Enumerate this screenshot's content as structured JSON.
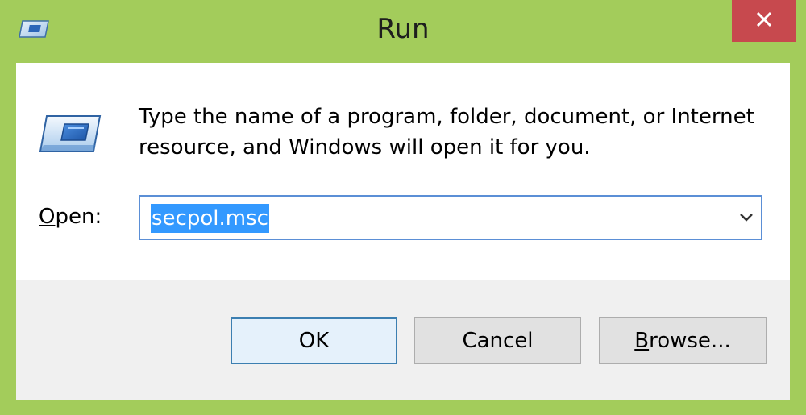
{
  "window": {
    "title": "Run",
    "accent_color": "#a3cc5b",
    "close_color": "#c7494e",
    "close_icon": "close-icon",
    "title_icon": "run-icon"
  },
  "dialog": {
    "description": "Type the name of a program, folder, document, or Internet resource, and Windows will open it for you.",
    "open_label_mnemonic": "O",
    "open_label_rest": "pen:",
    "open_value": "secpol.msc",
    "dropdown_icon": "chevron-down-icon"
  },
  "buttons": {
    "ok_label": "OK",
    "cancel_label": "Cancel",
    "browse_mnemonic": "B",
    "browse_rest": "rowse..."
  }
}
